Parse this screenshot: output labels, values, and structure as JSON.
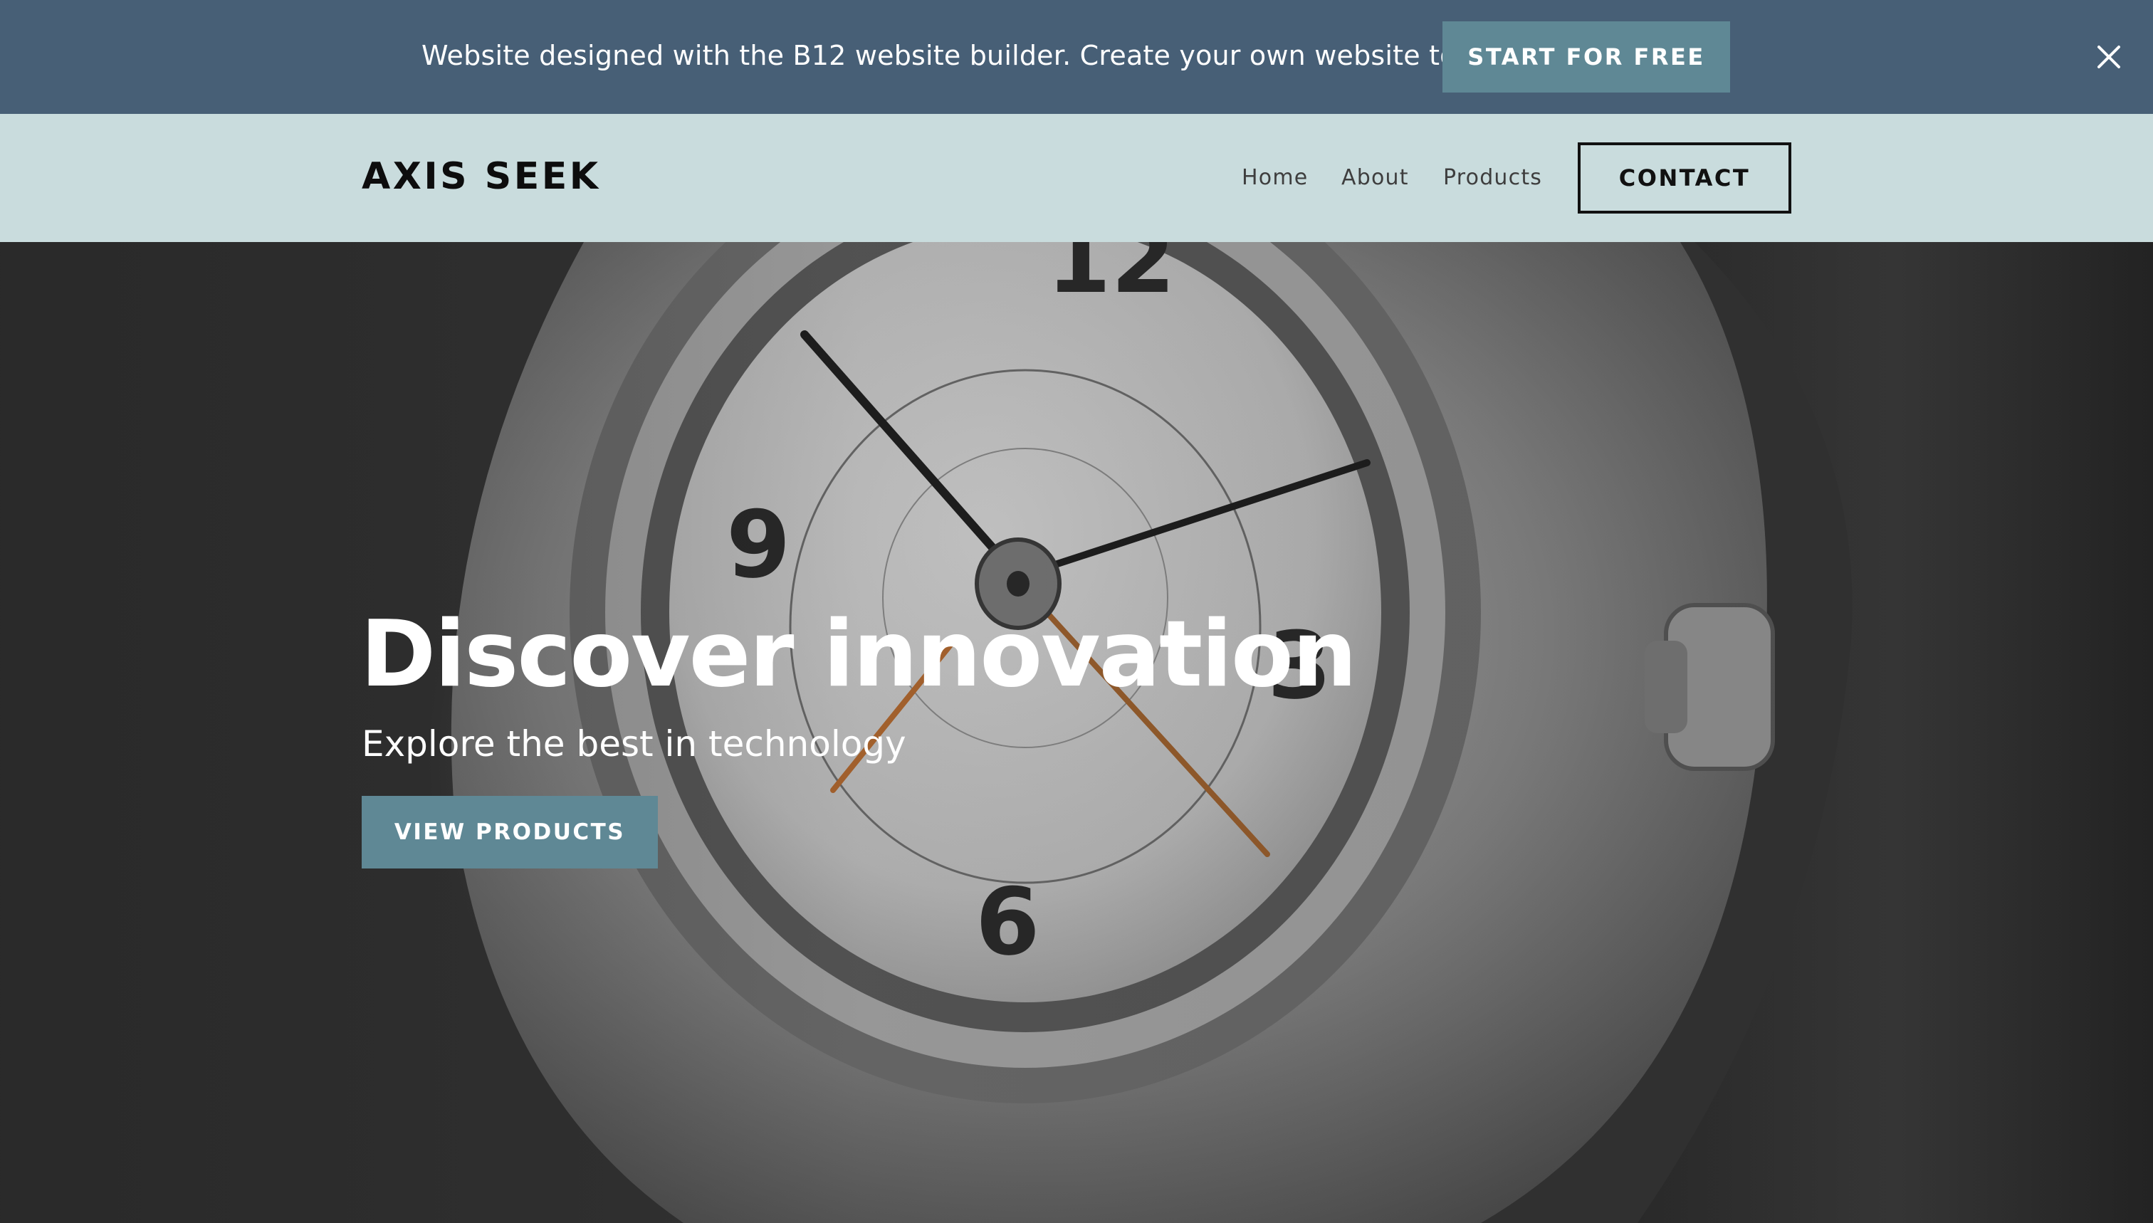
{
  "promo": {
    "text": "Website designed with the B12 website builder. Create your own website today.",
    "cta_label": "START FOR FREE",
    "close_icon": "close-icon",
    "background": "#475f76",
    "cta_color": "#5f8895"
  },
  "header": {
    "logo": "AXIS SEEK",
    "nav": {
      "home": "Home",
      "about": "About",
      "products": "Products"
    },
    "contact_label": "CONTACT",
    "background": "#c9dcdd"
  },
  "hero": {
    "title": "Discover innovation",
    "subtitle": "Explore the best in technology",
    "cta_label": "VIEW PRODUCTS",
    "image": "wristwatch-photo",
    "cta_color": "#5f8895"
  }
}
